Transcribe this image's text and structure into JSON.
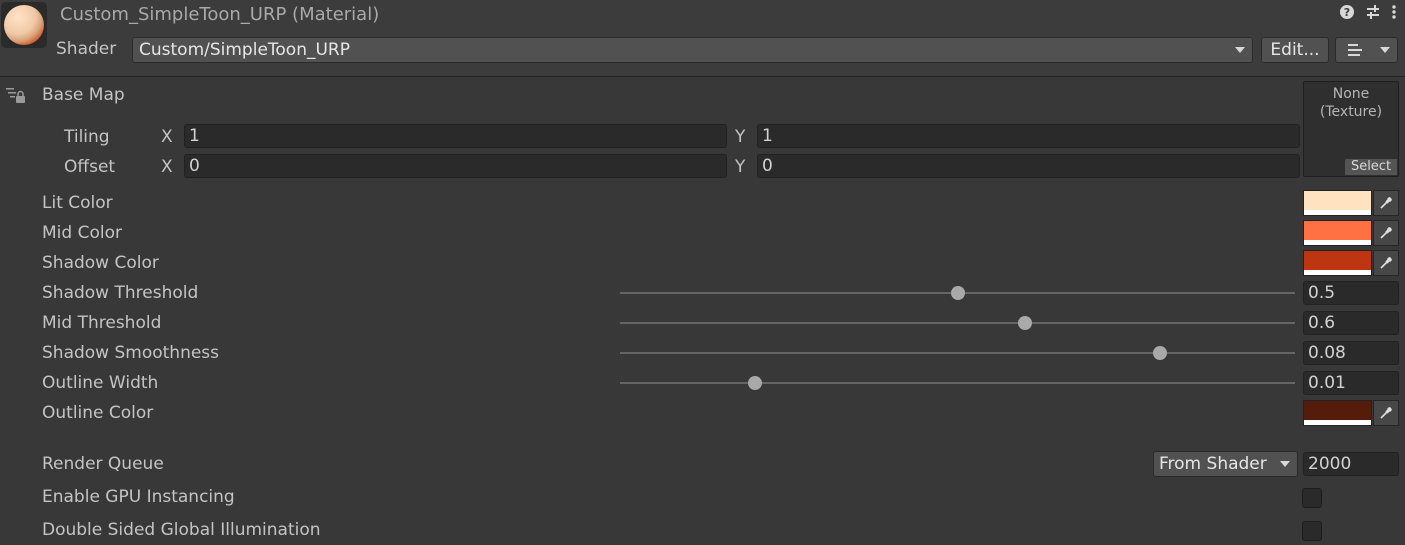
{
  "header": {
    "title": "Custom_SimpleToon_URP (Material)",
    "shader_label": "Shader",
    "shader_value": "Custom/SimpleToon_URP",
    "edit_label": "Edit...",
    "icons": [
      "help-icon",
      "settings-sliders-icon",
      "kebab-menu-icon",
      "list-menu-icon"
    ]
  },
  "base_map": {
    "label": "Base Map",
    "tiling_label": "Tiling",
    "offset_label": "Offset",
    "x_label": "X",
    "y_label": "Y",
    "tiling_x": "1",
    "tiling_y": "1",
    "offset_x": "0",
    "offset_y": "0",
    "texture_none": "None",
    "texture_type": "(Texture)",
    "select_label": "Select"
  },
  "colors": [
    {
      "label": "Lit Color",
      "hex": "#FFE3C1"
    },
    {
      "label": "Mid Color",
      "hex": "#FF7043"
    },
    {
      "label": "Shadow Color",
      "hex": "#BE3512"
    }
  ],
  "sliders": [
    {
      "label": "Shadow Threshold",
      "value": "0.5",
      "fraction": 0.5
    },
    {
      "label": "Mid Threshold",
      "value": "0.6",
      "fraction": 0.6
    },
    {
      "label": "Shadow Smoothness",
      "value": "0.08",
      "fraction": 0.8
    },
    {
      "label": "Outline Width",
      "value": "0.01",
      "fraction": 0.2
    }
  ],
  "outline_color": {
    "label": "Outline Color",
    "hex": "#551C0C"
  },
  "render_queue": {
    "label": "Render Queue",
    "mode": "From Shader",
    "value": "2000"
  },
  "gpu_instancing": {
    "label": "Enable GPU Instancing",
    "checked": false
  },
  "double_sided_gi": {
    "label": "Double Sided Global Illumination",
    "checked": false
  }
}
